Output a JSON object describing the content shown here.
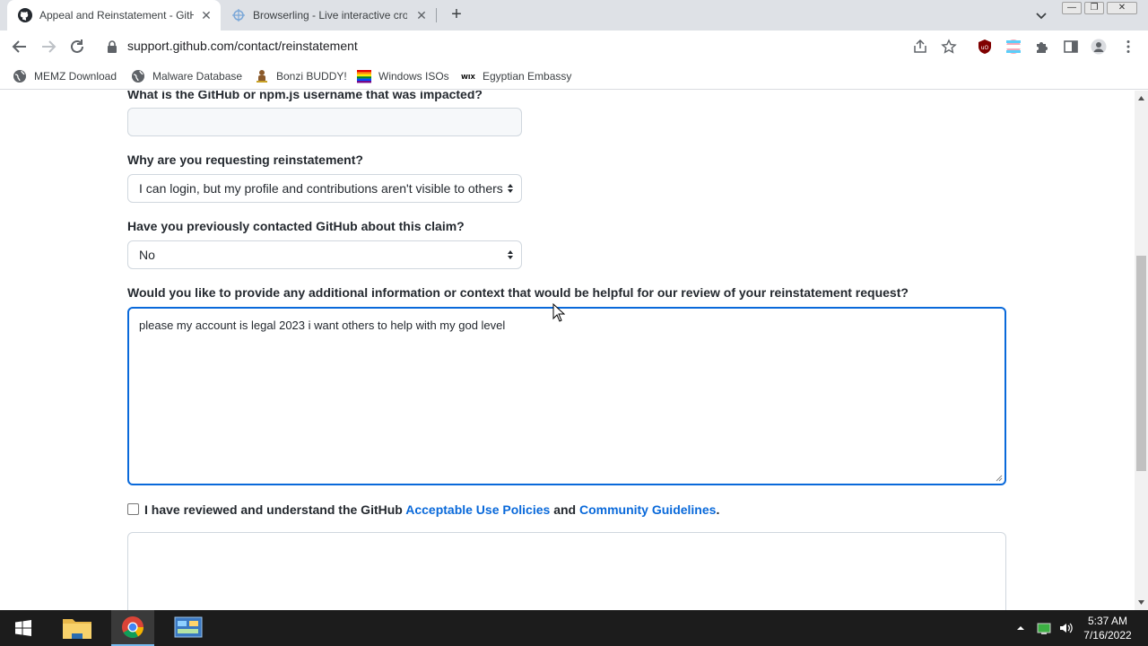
{
  "browser": {
    "tabs": [
      {
        "title": "Appeal and Reinstatement - GitHub",
        "icon": "github-icon",
        "active": true
      },
      {
        "title": "Browserling - Live interactive cross-browser testing",
        "icon": "browserling-icon",
        "active": false
      }
    ],
    "url": "support.github.com/contact/reinstatement",
    "bookmarks": [
      {
        "label": "MEMZ Download",
        "icon": "globe-icon"
      },
      {
        "label": "Malware Database",
        "icon": "globe-icon"
      },
      {
        "label": "Bonzi BUDDY!",
        "icon": "bonzi-icon"
      },
      {
        "label": "Windows ISOs",
        "icon": "rainbow-flag-icon"
      },
      {
        "label": "Egyptian Embassy",
        "icon": "wix-icon"
      }
    ],
    "wix_text": "WIX"
  },
  "form": {
    "username_label": "What is the GitHub or npm.js username that was impacted?",
    "username_value": "",
    "reason_label": "Why are you requesting reinstatement?",
    "reason_value": "I can login, but my profile and contributions aren't visible to others",
    "contacted_label": "Have you previously contacted GitHub about this claim?",
    "contacted_value": "No",
    "details_label": "Would you like to provide any additional information or context that would be helpful for our review of your reinstatement request?",
    "details_value": "please my account is legal 2023 i want others to help with my god level",
    "policy_prefix": "I have reviewed and understand the GitHub",
    "policy_link1": "Acceptable Use Policies",
    "policy_and": "and",
    "policy_link2": "Community Guidelines",
    "policy_suffix": ".",
    "policy_checked": false
  },
  "taskbar": {
    "time": "5:37 AM",
    "date": "7/16/2022",
    "apps": [
      "windows-start-icon",
      "file-explorer-icon",
      "chrome-icon",
      "control-panel-icon"
    ]
  },
  "colors": {
    "link": "#0969da",
    "focus": "#0969da",
    "taskbar": "#1c1c1c"
  }
}
